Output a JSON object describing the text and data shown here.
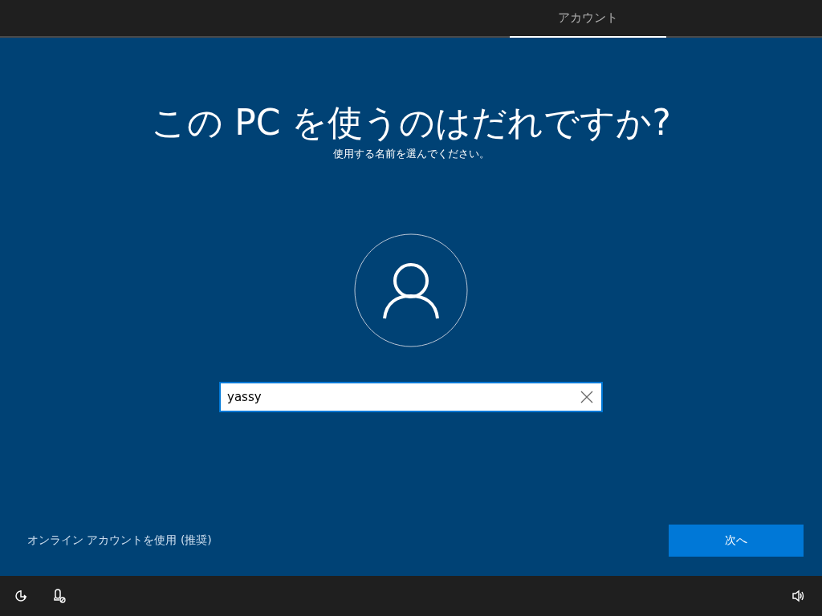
{
  "tabs": [
    {
      "label": "アカウント",
      "selected": true
    }
  ],
  "heading": "この PC を使うのはだれですか?",
  "subheading": "使用する名前を選んでください。",
  "name_field": {
    "value": "yassy"
  },
  "online_account_link": "オンライン アカウントを使用 (推奨)",
  "next_button": "次へ"
}
